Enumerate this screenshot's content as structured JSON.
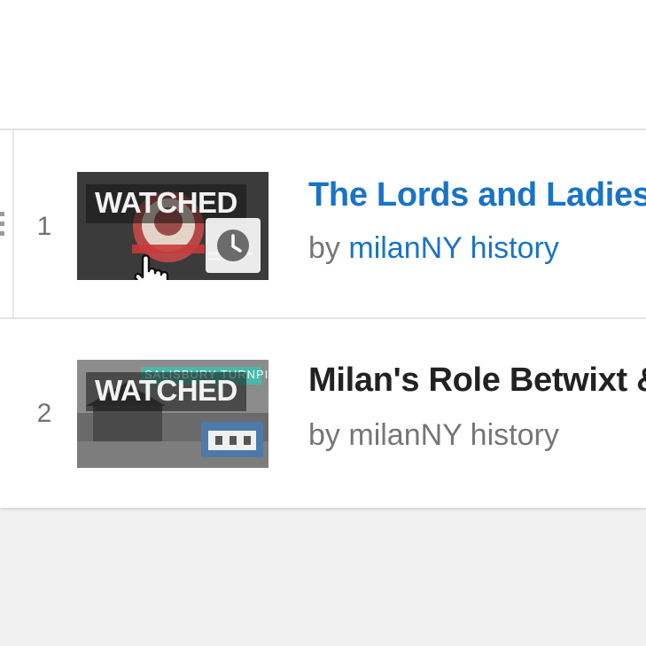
{
  "playlist": {
    "items": [
      {
        "index": "1",
        "overlay": "WATCHED",
        "title": "The Lords and Ladies",
        "by_prefix": "by",
        "channel": "milanNY history"
      },
      {
        "index": "2",
        "overlay": "WATCHED",
        "title": "Milan's Role Betwixt &",
        "by_prefix": "by",
        "channel": "milanNY history",
        "thumb_banner": "SALISBURY TURNPIKE"
      }
    ]
  },
  "colors": {
    "link": "#1a73c7",
    "muted_text": "#767676",
    "page_background": "#f1f1f1"
  }
}
